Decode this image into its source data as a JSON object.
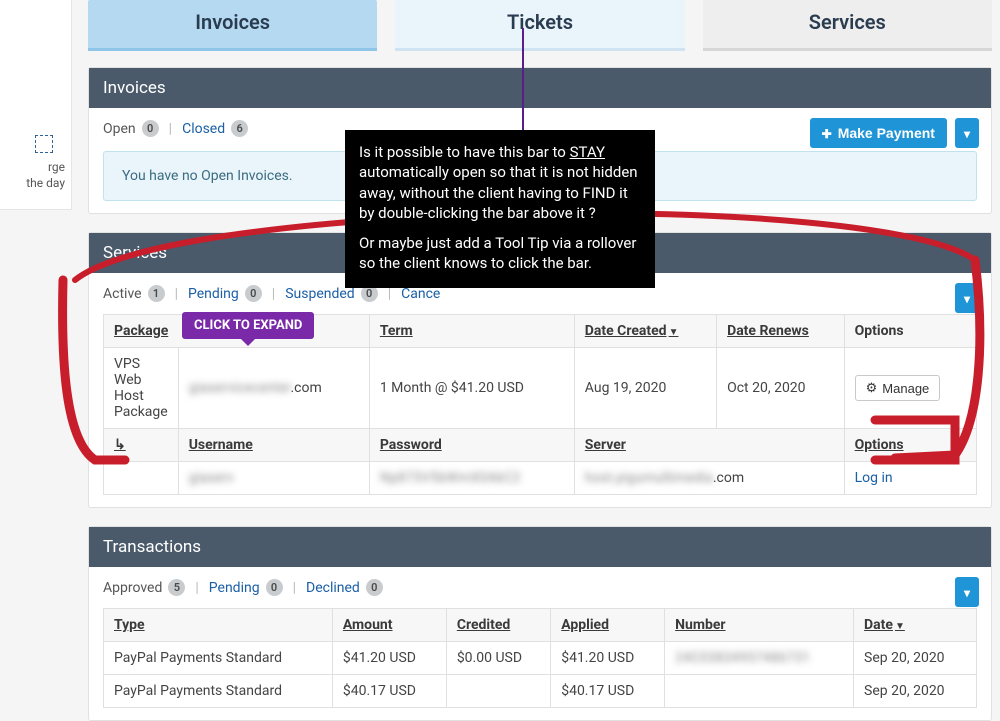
{
  "sidebar": {
    "hint_line1": "rge",
    "hint_line2": "the day"
  },
  "tabs": {
    "invoices": "Invoices",
    "tickets": "Tickets",
    "services": "Services"
  },
  "invoices": {
    "title": "Invoices",
    "open_label": "Open",
    "open_count": "0",
    "closed_label": "Closed",
    "closed_count": "6",
    "make_payment": "Make Payment",
    "empty_msg": "You have no Open Invoices."
  },
  "services": {
    "title": "Services",
    "active_label": "Active",
    "active_count": "1",
    "pending_label": "Pending",
    "pending_count": "0",
    "suspended_label": "Suspended",
    "suspended_count": "0",
    "cancelled_label": "Cance",
    "cols": {
      "package": "Package",
      "term": "Term",
      "created": "Date Created",
      "renews": "Date Renews",
      "options": "Options"
    },
    "row": {
      "package": "VPS Web Host Package",
      "domain_blur": "giaservicecenter",
      "domain_tail": ".com",
      "term": "1 Month @ $41.20 USD",
      "created": "Aug 19, 2020",
      "renews": "Oct 20, 2020",
      "manage": "Manage"
    },
    "sub": {
      "cols": {
        "username": "Username",
        "password": "Password",
        "server": "Server",
        "options": "Options"
      },
      "username_blur": "giaserv",
      "password_blur": "Np873V5bWmX0AkC2",
      "server_blur": "host.pigumultimedia",
      "server_tail": ".com",
      "login": "Log in"
    }
  },
  "transactions": {
    "title": "Transactions",
    "approved_label": "Approved",
    "approved_count": "5",
    "pending_label": "Pending",
    "pending_count": "0",
    "declined_label": "Declined",
    "declined_count": "0",
    "cols": {
      "type": "Type",
      "amount": "Amount",
      "credited": "Credited",
      "applied": "Applied",
      "number": "Number",
      "date": "Date"
    },
    "rows": [
      {
        "type": "PayPal Payments Standard",
        "amount": "$41.20 USD",
        "credited": "$0.00 USD",
        "applied": "$41.20 USD",
        "number_blur": "24C03834957486731",
        "date": "Sep 20, 2020"
      },
      {
        "type": "PayPal Payments Standard",
        "amount": "$40.17 USD",
        "credited": "",
        "applied": "$40.17 USD",
        "number_blur": "",
        "date": "Sep 20, 2020"
      }
    ]
  },
  "tooltip": "CLICK TO EXPAND",
  "annotation": {
    "p1a": "Is it possible to have this bar to ",
    "p1u": "STAY",
    "p1b": " automatically open so that it is not hidden away, without the client having to FIND it by double-clicking the bar above it ?",
    "p2": "Or maybe just add a Tool Tip via a rollover so the client knows to click the bar."
  }
}
